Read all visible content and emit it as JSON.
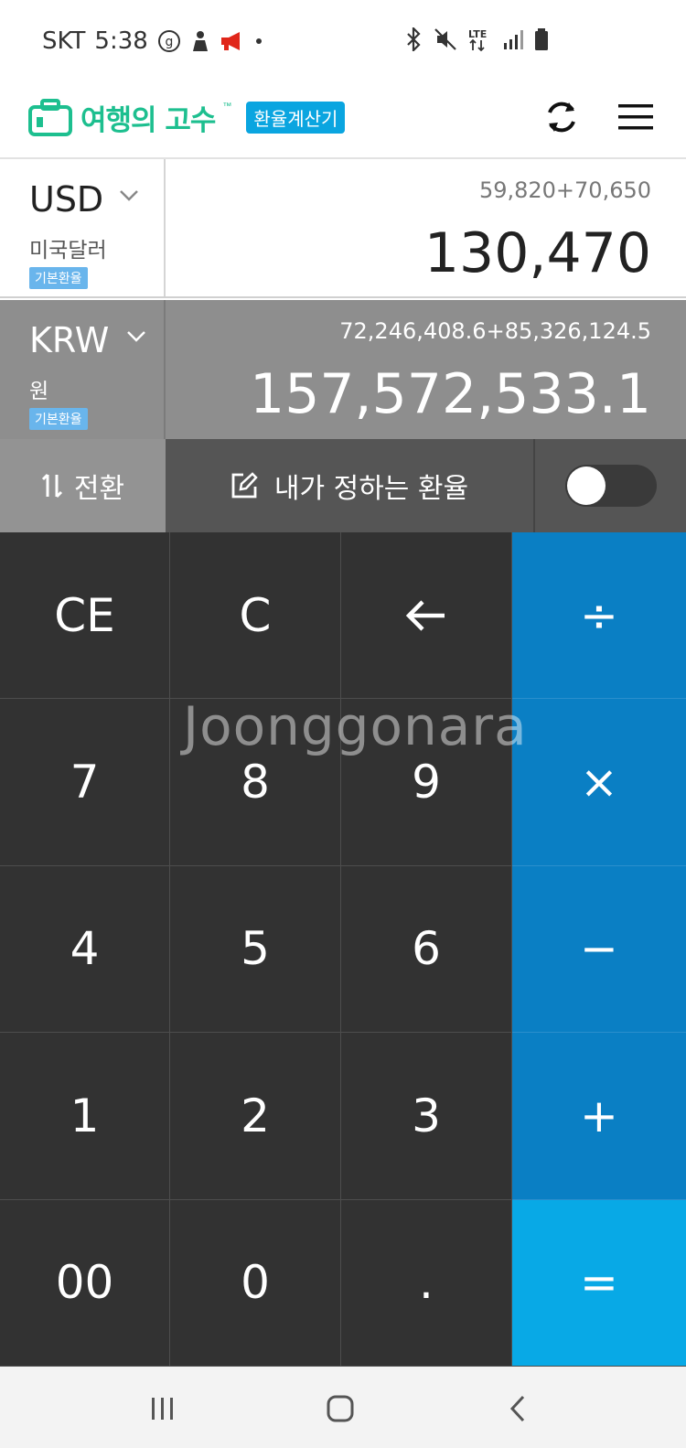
{
  "status_bar": {
    "carrier": "SKT",
    "time": "5:38",
    "network": "LTE"
  },
  "header": {
    "logo_text": "여행의 고수",
    "logo_tm": "™",
    "calc_badge": "환율계산기"
  },
  "rows": [
    {
      "code": "USD",
      "name": "미국달러",
      "badge": "기본환율",
      "expression": "59,820+70,650",
      "value": "130,470"
    },
    {
      "code": "KRW",
      "name": "원",
      "badge": "기본환율",
      "expression": "72,246,408.6+85,326,124.5",
      "value": "157,572,533.1"
    }
  ],
  "options": {
    "switch_label": "전환",
    "custom_rate_label": "내가 정하는 환율",
    "custom_rate_enabled": false
  },
  "keypad": {
    "keys": [
      "CE",
      "C",
      "←",
      "÷",
      "7",
      "8",
      "9",
      "×",
      "4",
      "5",
      "6",
      "−",
      "1",
      "2",
      "3",
      "+",
      "00",
      "0",
      ".",
      "="
    ]
  },
  "watermark": "Joonggonara",
  "colors": {
    "brand_green": "#1dbf8f",
    "badge_blue": "#0aa5e0",
    "operator_blue": "#0a7fc4",
    "equals_blue": "#08a9e6",
    "key_dark": "#323232"
  }
}
